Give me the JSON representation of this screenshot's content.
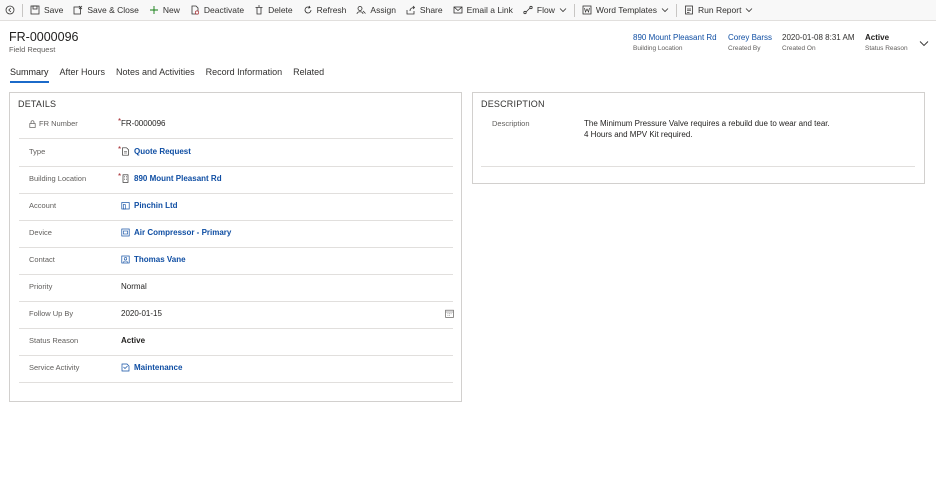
{
  "toolbar": {
    "items": [
      {
        "label": "Save",
        "icon": "save-icon"
      },
      {
        "label": "Save & Close",
        "icon": "save-close-icon"
      },
      {
        "label": "New",
        "icon": "plus-icon"
      },
      {
        "label": "Deactivate",
        "icon": "deactivate-icon"
      },
      {
        "label": "Delete",
        "icon": "trash-icon"
      },
      {
        "label": "Refresh",
        "icon": "refresh-icon"
      },
      {
        "label": "Assign",
        "icon": "assign-icon"
      },
      {
        "label": "Share",
        "icon": "share-icon"
      },
      {
        "label": "Email a Link",
        "icon": "email-icon"
      },
      {
        "label": "Flow",
        "icon": "flow-icon"
      },
      {
        "label": "Word Templates",
        "icon": "word-icon"
      },
      {
        "label": "Run Report",
        "icon": "report-icon"
      }
    ]
  },
  "record": {
    "title": "FR-0000096",
    "entity": "Field Request"
  },
  "header_fields": [
    {
      "value": "890 Mount Pleasant Rd",
      "label": "Building Location"
    },
    {
      "value": "Corey Barss",
      "label": "Created By"
    },
    {
      "value": "2020-01-08 8:31 AM",
      "label": "Created On"
    },
    {
      "value": "Active",
      "label": "Status Reason"
    }
  ],
  "tabs": [
    {
      "label": "Summary",
      "active": true
    },
    {
      "label": "After Hours"
    },
    {
      "label": "Notes and Activities"
    },
    {
      "label": "Record Information"
    },
    {
      "label": "Related"
    }
  ],
  "details": {
    "title": "DETAILS",
    "fields": [
      {
        "label": "FR Number",
        "value": "FR-0000096",
        "required": true,
        "locked": true
      },
      {
        "label": "Type",
        "value": "Quote Request",
        "required": true,
        "link": true,
        "icon": "lookup-record-icon"
      },
      {
        "label": "Building Location",
        "value": "890 Mount Pleasant Rd",
        "required": true,
        "link": true,
        "icon": "building-icon"
      },
      {
        "label": "Account",
        "value": "Pinchin Ltd",
        "link": true,
        "icon": "account-icon"
      },
      {
        "label": "Device",
        "value": "Air Compressor - Primary",
        "link": true,
        "icon": "device-icon"
      },
      {
        "label": "Contact",
        "value": "Thomas Vane",
        "link": true,
        "icon": "contact-icon"
      },
      {
        "label": "Priority",
        "value": "Normal"
      },
      {
        "label": "Follow Up By",
        "value": "2020-01-15",
        "date": true
      },
      {
        "label": "Status Reason",
        "value": "Active",
        "bold": true
      },
      {
        "label": "Service Activity",
        "value": "Maintenance",
        "link": true,
        "icon": "service-activity-icon"
      }
    ],
    "required_mark": "*"
  },
  "description": {
    "title": "DESCRIPTION",
    "label": "Description",
    "text": "The Minimum Pressure Valve requires a rebuild due to wear and tear.\n4 Hours and MPV Kit required."
  },
  "colors": {
    "link": "#0f4ea3",
    "accent": "#1b6ac9",
    "required": "#a4262c"
  }
}
